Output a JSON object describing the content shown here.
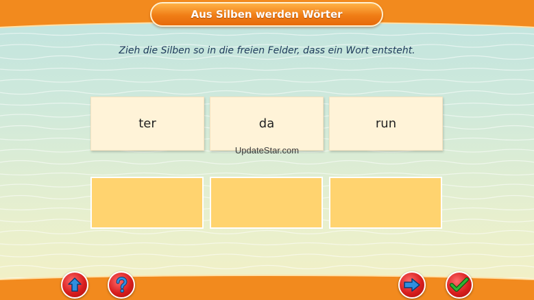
{
  "header": {
    "title": "Aus Silben werden Wörter"
  },
  "instruction": "Zieh die Silben so in die freien Felder, dass ein Wort entsteht.",
  "syllables": [
    "ter",
    "da",
    "run"
  ],
  "watermark": "UpdateStar.com",
  "controls": {
    "back": "up-arrow-icon",
    "help": "question-mark-icon",
    "next": "right-arrow-icon",
    "check": "checkmark-icon"
  },
  "colors": {
    "accent": "#f07d16",
    "slot": "#ffd36f",
    "card": "#fff3d8",
    "button": "#d81e1e",
    "icon_blue": "#2f8fe0",
    "icon_green": "#2fb533"
  }
}
